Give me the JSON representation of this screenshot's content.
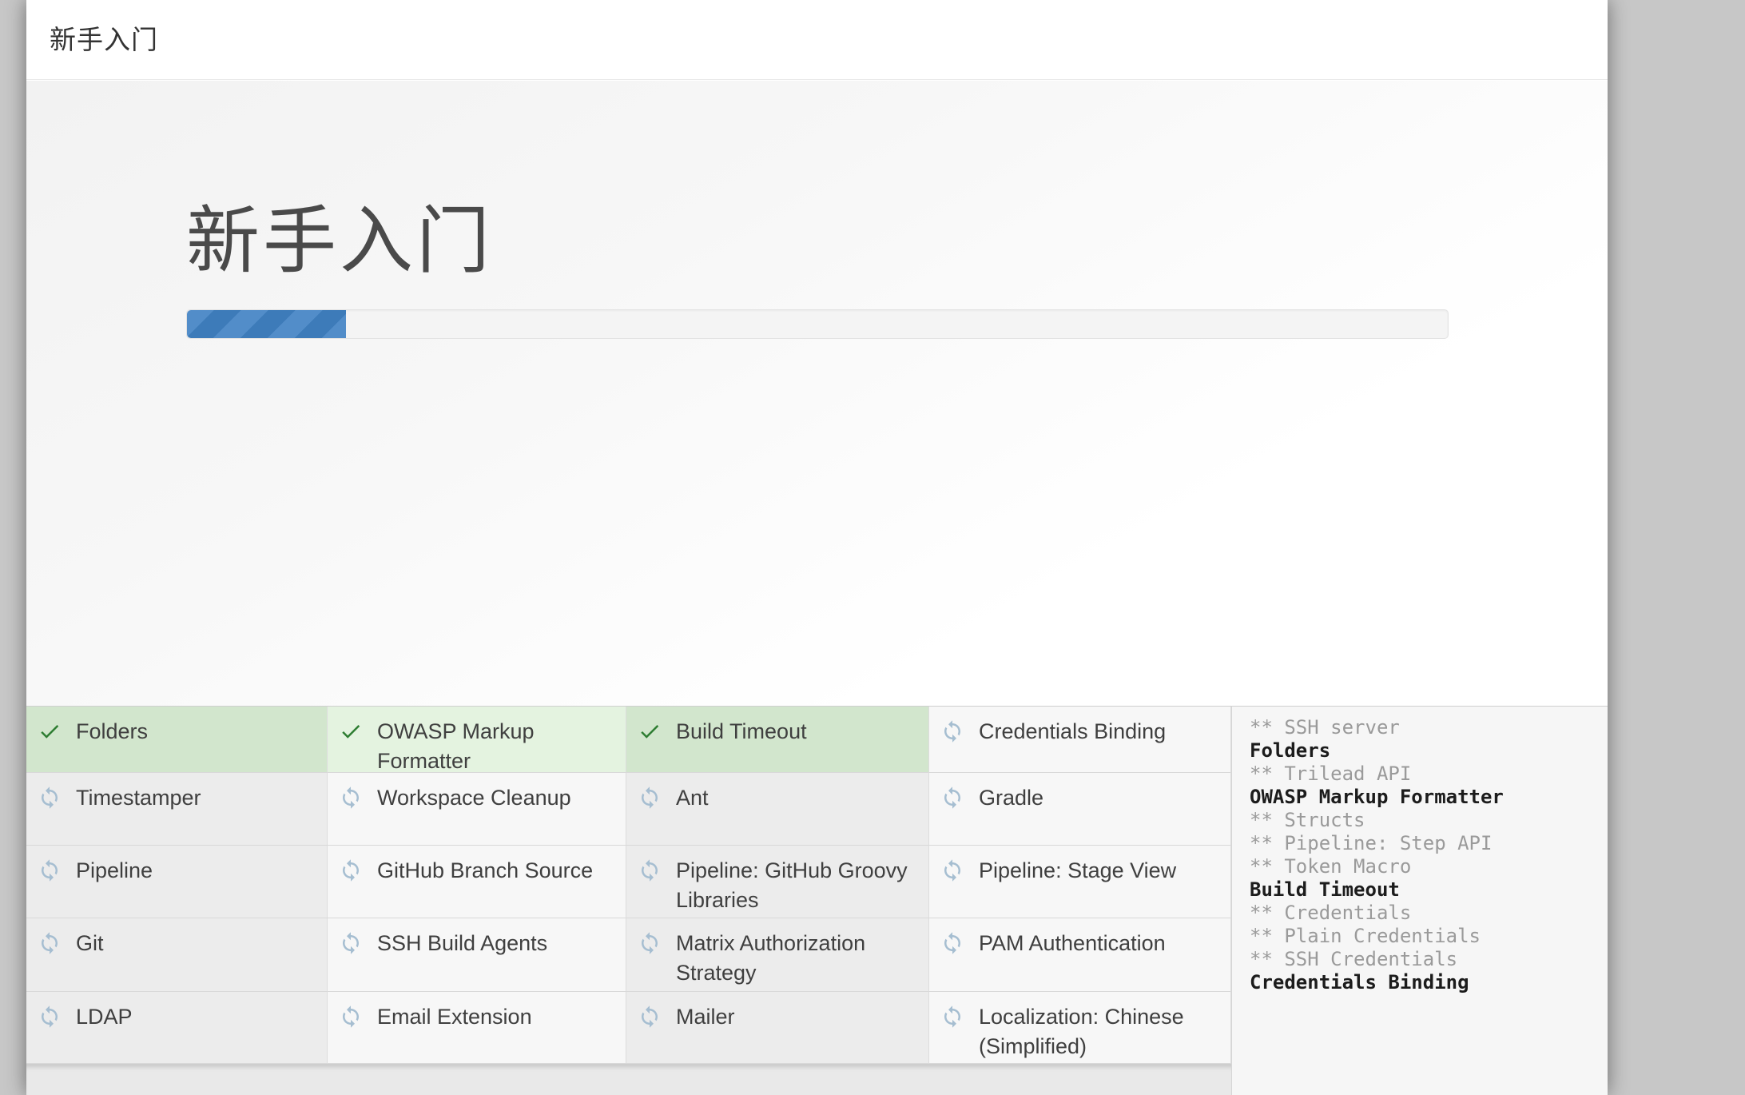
{
  "window": {
    "title": "新手入门"
  },
  "hero": {
    "title": "新手入门",
    "progress_percent": 12.6
  },
  "plugins": {
    "columns": 4,
    "items": [
      {
        "name": "Folders",
        "state": "done"
      },
      {
        "name": "OWASP Markup Formatter",
        "state": "done"
      },
      {
        "name": "Build Timeout",
        "state": "done"
      },
      {
        "name": "Credentials Binding",
        "state": "installing"
      },
      {
        "name": "Timestamper",
        "state": "pending"
      },
      {
        "name": "Workspace Cleanup",
        "state": "pending"
      },
      {
        "name": "Ant",
        "state": "pending"
      },
      {
        "name": "Gradle",
        "state": "pending"
      },
      {
        "name": "Pipeline",
        "state": "pending"
      },
      {
        "name": "GitHub Branch Source",
        "state": "pending"
      },
      {
        "name": "Pipeline: GitHub Groovy Libraries",
        "state": "pending"
      },
      {
        "name": "Pipeline: Stage View",
        "state": "pending"
      },
      {
        "name": "Git",
        "state": "pending"
      },
      {
        "name": "SSH Build Agents",
        "state": "pending"
      },
      {
        "name": "Matrix Authorization Strategy",
        "state": "pending"
      },
      {
        "name": "PAM Authentication",
        "state": "pending"
      },
      {
        "name": "LDAP",
        "state": "pending"
      },
      {
        "name": "Email Extension",
        "state": "pending"
      },
      {
        "name": "Mailer",
        "state": "pending"
      },
      {
        "name": "Localization: Chinese (Simplified)",
        "state": "pending"
      }
    ]
  },
  "log": {
    "lines": [
      {
        "text": "** SSH server",
        "style": "dim"
      },
      {
        "text": "Folders",
        "style": "strong"
      },
      {
        "text": "** Trilead API",
        "style": "dim"
      },
      {
        "text": "OWASP Markup Formatter",
        "style": "strong"
      },
      {
        "text": "** Structs",
        "style": "dim"
      },
      {
        "text": "** Pipeline: Step API",
        "style": "dim"
      },
      {
        "text": "** Token Macro",
        "style": "dim"
      },
      {
        "text": "Build Timeout",
        "style": "strong"
      },
      {
        "text": "** Credentials",
        "style": "dim"
      },
      {
        "text": "** Plain Credentials",
        "style": "dim"
      },
      {
        "text": "** SSH Credentials",
        "style": "dim"
      },
      {
        "text": "Credentials Binding",
        "style": "strong"
      }
    ]
  },
  "icons": {
    "done": "check-icon",
    "pending": "sync-icon"
  },
  "colors": {
    "pageBg": "#c7c7c7",
    "accentDark": "#3d7bb9",
    "accentLight": "#528dc9",
    "trackBg": "#f4f4f4",
    "trackBorder": "#e3e3e3",
    "checkGreen": "#2e7d32",
    "syncBlue": "#a6bed1",
    "doneOdd": "#d2e6cd",
    "doneEven": "#e4f3e0",
    "colOdd": "#ececec",
    "colEven": "#f7f7f7",
    "footerBg": "#e9e9e9",
    "logBg": "#f6f6f6",
    "logDim": "#9a9a9a",
    "logStrong": "#1c1c1c"
  }
}
